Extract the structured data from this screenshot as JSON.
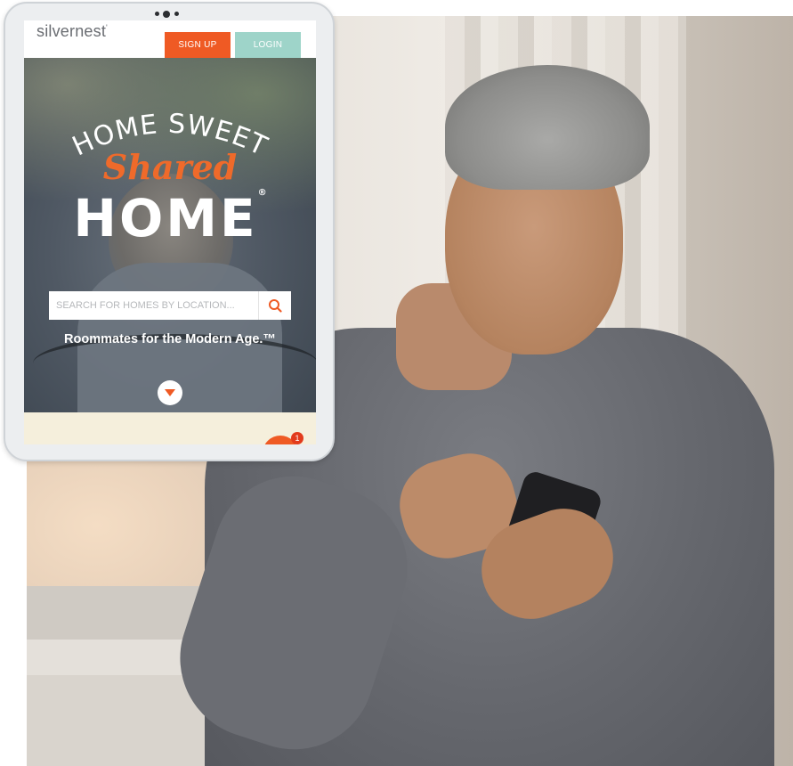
{
  "app": {
    "logo_text": "silvernest",
    "logo_mark": "'",
    "brand_colors": {
      "accent": "#ef5a24",
      "secondary": "#9ed4c9"
    }
  },
  "header": {
    "signup_label": "SIGN UP",
    "login_label": "LOGIN"
  },
  "hero": {
    "title_line1": "HOME SWEET",
    "title_line2": "Shared",
    "title_line3": "HOME",
    "title_mark": "®",
    "search": {
      "placeholder": "SEARCH FOR HOMES BY LOCATION...",
      "icon": "search-icon"
    },
    "tagline": "Roommates for the Modern Age.™",
    "scroll_icon": "chevron-down-icon"
  },
  "chat": {
    "badge_count": "1",
    "icon": "chat-bubble-icon"
  }
}
